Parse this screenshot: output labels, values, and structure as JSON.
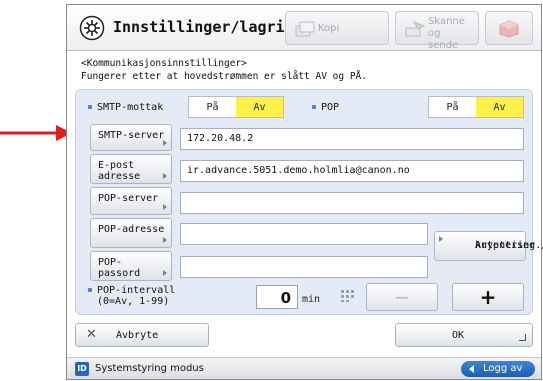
{
  "header": {
    "title": "Innstillinger/lagring",
    "mode_buttons": {
      "kopi": "Kopi",
      "skanne_line1": "Skanne og",
      "skanne_line2": "sende"
    }
  },
  "info": {
    "line1": "<Kommunikasjonsinnstillinger>",
    "line2": "Fungerer etter at hovedstrømmen er slått AV og PÅ."
  },
  "smtp_receive": {
    "label": "SMTP-mottak",
    "on": "På",
    "off": "Av",
    "selected": "Av"
  },
  "pop": {
    "label": "POP",
    "on": "På",
    "off": "Av",
    "selected": "Av"
  },
  "fields": {
    "smtp_server": {
      "label": "SMTP-server",
      "value": "172.20.48.2"
    },
    "email_address": {
      "label_line1": "E-post",
      "label_line2": "adresse",
      "value": "ir.advance.5051.demo.holmlia@canon.no"
    },
    "pop_server": {
      "label": "POP-server",
      "value": ""
    },
    "pop_address": {
      "label": "POP-adresse",
      "value": ""
    },
    "pop_password": {
      "label_line1": "POP-",
      "label_line2": "passord",
      "value": ""
    }
  },
  "auth_button": {
    "line1": "Autentiser./",
    "line2": "kryptering"
  },
  "pop_interval": {
    "label_line1": "POP-intervall",
    "label_line2": "(0=Av, 1-99)",
    "value": "0",
    "unit": "min",
    "minus": "−",
    "plus": "+"
  },
  "footer": {
    "cancel_label": "Avbryte",
    "ok_label": "OK"
  },
  "status": {
    "badge": "ID",
    "mode_text": "Systemstyring modus",
    "logout_label": "Logg av"
  },
  "colors": {
    "selected_toggle": "#fff04a",
    "panel_bg": "#e4ebf7",
    "arrow": "#e02020",
    "logout": "#1f5fae"
  }
}
